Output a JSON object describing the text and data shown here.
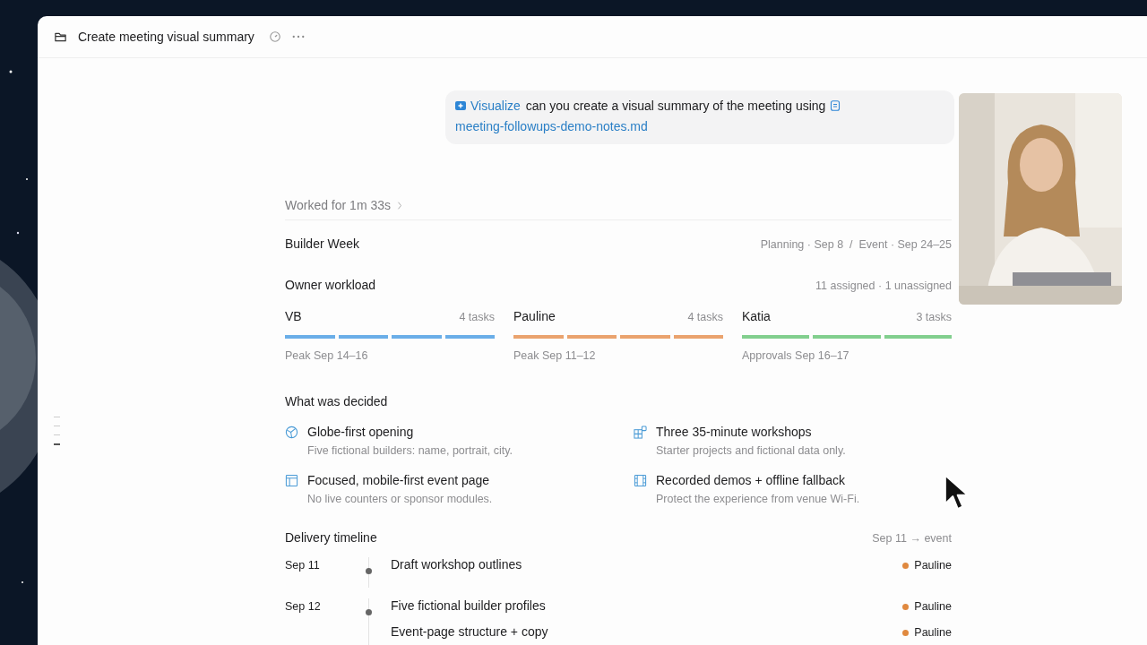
{
  "window": {
    "title": "Create meeting visual summary"
  },
  "message": {
    "tool": "Visualize",
    "text": "can you create a visual summary of the meeting using",
    "file": "meeting-followups-demo-notes.md"
  },
  "worked": "Worked for 1m 33s",
  "summary": {
    "title": "Builder Week",
    "meta": "Planning · Sep 8  /  Event · Sep 24–25"
  },
  "workload": {
    "title": "Owner workload",
    "meta": "11 assigned · 1 unassigned",
    "owners": [
      {
        "name": "VB",
        "tasks": "4 tasks",
        "note": "Peak Sep 14–16",
        "color": "#6aaee8"
      },
      {
        "name": "Pauline",
        "tasks": "4 tasks",
        "note": "Peak Sep 11–12",
        "color": "#eaa36e"
      },
      {
        "name": "Katia",
        "tasks": "3 tasks",
        "note": "Approvals Sep 16–17",
        "color": "#82cf8e"
      }
    ]
  },
  "decided": {
    "title": "What was decided",
    "items": [
      {
        "kind": "globe",
        "title": "Globe-first opening",
        "note": "Five fictional builders: name, portrait, city."
      },
      {
        "kind": "blocks",
        "title": "Three 35-minute workshops",
        "note": "Starter projects and fictional data only."
      },
      {
        "kind": "layout",
        "title": "Focused, mobile-first event page",
        "note": "No live counters or sponsor modules."
      },
      {
        "kind": "film",
        "title": "Recorded demos + offline fallback",
        "note": "Protect the experience from venue Wi-Fi."
      }
    ]
  },
  "timeline": {
    "title": "Delivery timeline",
    "meta": "Sep 11 → event",
    "days": [
      {
        "date": "Sep 11",
        "items": [
          {
            "title": "Draft workshop outlines",
            "owner": "Pauline",
            "color": "#e0893f"
          }
        ]
      },
      {
        "date": "Sep 12",
        "items": [
          {
            "title": "Five fictional builder profiles",
            "owner": "Pauline",
            "color": "#e0893f"
          },
          {
            "title": "Event-page structure + copy",
            "owner": "Pauline",
            "color": "#e0893f"
          }
        ]
      }
    ]
  }
}
